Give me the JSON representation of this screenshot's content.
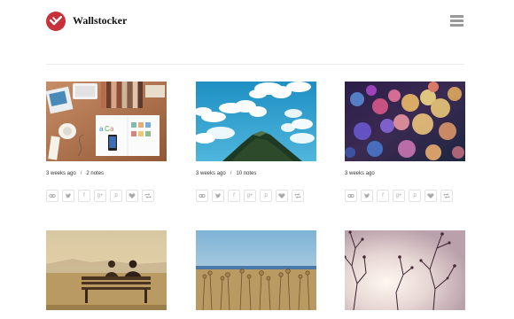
{
  "site": {
    "name": "Wallstocker"
  },
  "posts": [
    {
      "time": "3 weeks ago",
      "notes": "2 notes"
    },
    {
      "time": "3 weeks ago",
      "notes": "10 notes"
    },
    {
      "time": "3 weeks ago",
      "notes": ""
    }
  ],
  "share_icons": [
    "link-icon",
    "twitter-icon",
    "facebook-icon",
    "google-plus-icon",
    "pinterest-icon",
    "heart-icon",
    "reblog-icon"
  ],
  "share_labels": {
    "facebook": "f",
    "google_plus": "g+",
    "pinterest": "p"
  },
  "colors": {
    "brand": "#c8303a",
    "menu": "#9a9a9a",
    "icon": "#aaaaaa"
  }
}
